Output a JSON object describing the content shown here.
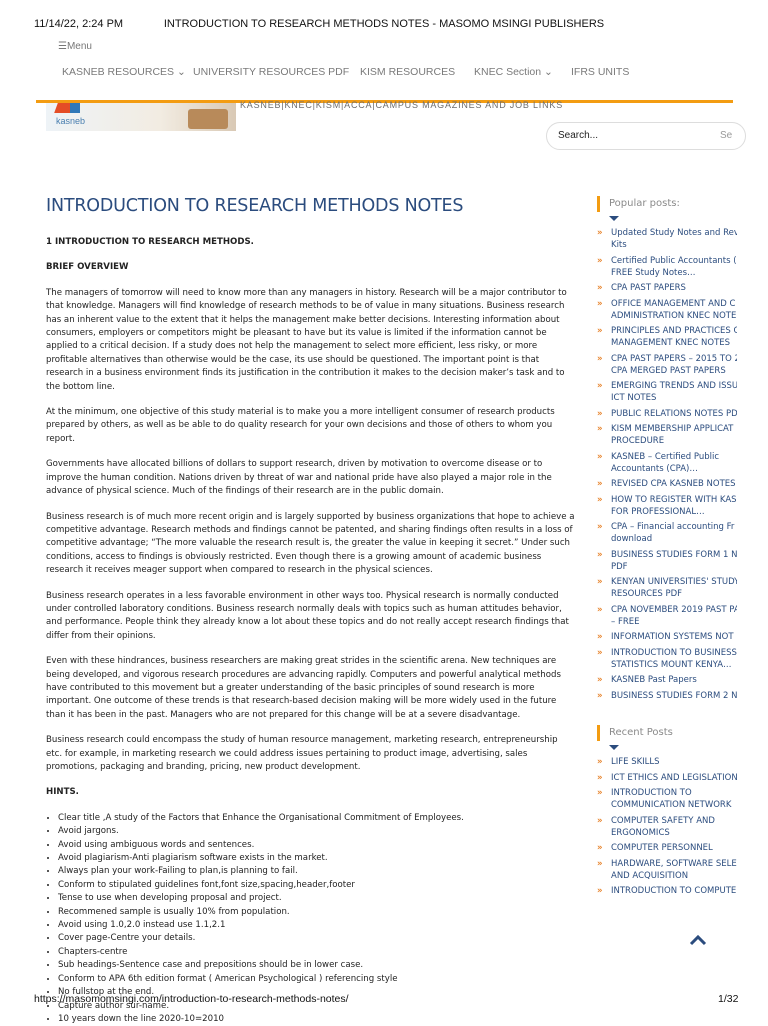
{
  "print_header": {
    "date": "11/14/22, 2:24 PM",
    "title": "INTRODUCTION TO RESEARCH METHODS NOTES - MASOMO MSINGI PUBLISHERS"
  },
  "menu_label": "☰Menu",
  "nav": [
    {
      "label": "KASNEB RESOURCES",
      "dropdown": true
    },
    {
      "label": "UNIVERSITY RESOURCES PDF",
      "dropdown": false
    },
    {
      "label": "KISM RESOURCES",
      "dropdown": false
    },
    {
      "label": "KNEC Section",
      "dropdown": true
    },
    {
      "label": "IFRS UNITS",
      "dropdown": false
    }
  ],
  "logo_text": "kasneb",
  "tagline": "KASNEB|KNEC|KISM|ACCA|CAMPUS MAGAZINES AND JOB LINKS",
  "search": {
    "placeholder": "Search...",
    "button": "Se"
  },
  "article": {
    "title": "INTRODUCTION TO RESEARCH METHODS NOTES",
    "heading1": "1 INTRODUCTION TO RESEARCH METHODS.",
    "heading2": "BRIEF OVERVIEW",
    "paragraphs": [
      "The managers of tomorrow will need to know more than any managers in history.  Research will be a major contributor to that knowledge.  Managers will find knowledge of research methods to be of value in many situations.  Business research has an inherent value to the extent that it helps the management make better decisions. Interesting information about consumers, employers or competitors might be pleasant to have but its value is limited if the information cannot be applied to a critical decision.  If a study does not help the management to select more efficient, less risky, or more profitable alternatives than otherwise would be the case, its use should be questioned.  The important point is that research in a business environment finds its justification in the contribution it makes to the decision maker’s task and to the bottom line.",
      "At the minimum, one objective of this study material is to make you a more intelligent consumer of research products prepared by others, as well as be able to do quality research for your own decisions and those of others to whom you report.",
      "Governments have allocated billions of dollars to support  research, driven by motivation to overcome disease or to improve the human condition.  Nations driven by threat of war and national pride have also played a major role in the advance of physical science.  Much of the findings of their research are in the public domain.",
      "Business research is of much more recent origin and is largely supported by business organizations that hope to achieve a competitive advantage.  Research methods and findings cannot be patented, and sharing findings often results in a loss of competitive advantage; “The more valuable the research result is, the greater the value in keeping it secret.”  Under such conditions, access to findings is obviously restricted.  Even though there is a growing amount of academic business research it receives meager support when compared to research in the physical sciences.",
      "Business research operates in a less favorable environment in other ways too.  Physical research is normally conducted under controlled laboratory conditions. Business research normally deals with topics such as human attitudes behavior, and performance.  People think they already know a lot about these topics and do not really accept research findings that differ from their opinions.",
      "Even with these hindrances, business researchers are making great strides in the scientific arena.  New techniques are being developed, and vigorous research procedures are advancing rapidly.  Computers and powerful analytical methods have contributed to this movement but a greater understanding of the basic principles of sound research is more important. One outcome of these trends is that research-based decision making will be more widely used in the future than it has been in the past.  Managers who are not prepared for this change will be at a severe disadvantage.",
      "Business research could encompass the study of human resource management, marketing research, entrepreneurship  etc. for example, in marketing research we could address issues pertaining to product image, advertising, sales promotions, packaging and branding, pricing, new product development."
    ],
    "hints_heading": "HINTS.",
    "hints": [
      "Clear title ,A study of the Factors that Enhance the Organisational Commitment of Employees.",
      "Avoid jargons.",
      "Avoid using ambiguous words and sentences.",
      "Avoid plagiarism-Anti plagiarism software exists in the market.",
      "Always plan your work-Failing to plan,is planning to fail.",
      "Conform to stipulated guidelines font,font size,spacing,header,footer",
      "Tense to use when developing proposal and project.",
      "Recommened sample is usually 10% from population.",
      "Avoid using 1.0,2.0 instead use 1.1,2.1",
      "Cover page-Centre your details.",
      "Chapters-centre",
      "Sub headings-Sentence case and prepositions should be in lower case.",
      "Conform to APA 6th edition format ( American Psychological ) referencing style",
      "No fullstop at the end.",
      "Capture author sur-name.",
      "10 years down the line 2020-10=2010"
    ]
  },
  "sidebar": {
    "popular_title": "Popular posts:",
    "popular": [
      [
        "Updated Study Notes and Rev",
        "Kits"
      ],
      [
        "Certified Public Accountants (",
        "FREE Study Notes…"
      ],
      [
        "CPA PAST PAPERS"
      ],
      [
        "OFFICE MANAGEMENT AND C",
        "ADMINISTRATION KNEC NOTE"
      ],
      [
        "PRINCIPLES AND PRACTICES C",
        "MANAGEMENT KNEC NOTES"
      ],
      [
        "CPA PAST PAPERS – 2015 TO 2",
        "CPA MERGED PAST PAPERS"
      ],
      [
        "EMERGING TRENDS AND ISSU",
        "ICT NOTES"
      ],
      [
        "PUBLIC RELATIONS NOTES PD"
      ],
      [
        "KISM MEMBERSHIP APPLICAT",
        "PROCEDURE"
      ],
      [
        "KASNEB – Certified Public",
        "Accountants (CPA)…"
      ],
      [
        "REVISED CPA KASNEB NOTES"
      ],
      [
        "HOW TO REGISTER WITH KASI",
        "FOR PROFESSIONAL…"
      ],
      [
        "CPA – Financial accounting Fr",
        "download"
      ],
      [
        "BUSINESS STUDIES FORM 1 N",
        "PDF"
      ],
      [
        "KENYAN UNIVERSITIES' STUDY",
        "RESOURCES PDF"
      ],
      [
        "CPA NOVEMBER 2019 PAST PA",
        "– FREE"
      ],
      [
        "INFORMATION SYSTEMS NOT"
      ],
      [
        "INTRODUCTION TO BUSINESS",
        "STATISTICS MOUNT KENYA…"
      ],
      [
        "KASNEB Past Papers"
      ],
      [
        "BUSINESS STUDIES FORM 2 N"
      ]
    ],
    "recent_title": "Recent Posts",
    "recent": [
      [
        "LIFE SKILLS"
      ],
      [
        "ICT ETHICS AND LEGISLATION"
      ],
      [
        "INTRODUCTION TO",
        "COMMUNICATION NETWORK"
      ],
      [
        "COMPUTER SAFETY AND",
        "ERGONOMICS"
      ],
      [
        "COMPUTER PERSONNEL"
      ],
      [
        "HARDWARE, SOFTWARE SELEC",
        "AND ACQUISITION"
      ],
      [
        "INTRODUCTION TO COMPUTE"
      ]
    ]
  },
  "footer": {
    "url": "https://masomomsingi.com/introduction-to-research-methods-notes/",
    "page": "1/32"
  },
  "colors": {
    "accent": "#f39c12",
    "title": "#2b4c7e",
    "link": "#2b4c7e",
    "bullet": "#e67e22",
    "nav": "#7a7a7a"
  }
}
